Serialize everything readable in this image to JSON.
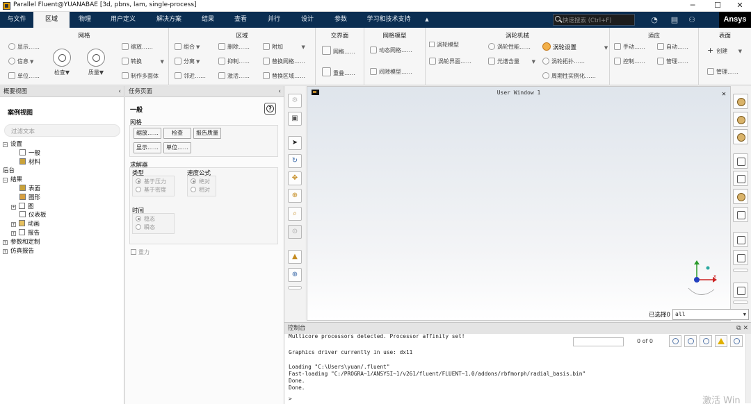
{
  "window": {
    "title": "Parallel Fluent@YUANABAE  [3d, pbns, lam, single-process]",
    "minimize": "─",
    "maximize": "☐",
    "close": "✕"
  },
  "menubar": {
    "items": [
      {
        "label": "与文件",
        "active": false
      },
      {
        "label": "区域",
        "active": true
      },
      {
        "label": "物理",
        "active": false
      },
      {
        "label": "用户定义",
        "active": false
      },
      {
        "label": "解决方案",
        "active": false
      },
      {
        "label": "结果",
        "active": false
      },
      {
        "label": "查看",
        "active": false
      },
      {
        "label": "并行",
        "active": false
      },
      {
        "label": "设计",
        "active": false
      },
      {
        "label": "参数",
        "active": false
      },
      {
        "label": "学习和技术支持",
        "active": false
      }
    ],
    "collapse_arrow": "▲",
    "search_placeholder": "快速搜索 (Ctrl+F)",
    "brand": "Ansys"
  },
  "ribbon": {
    "mesh": {
      "title": "网格",
      "display": "显示……",
      "info": "信息",
      "units": "单位……",
      "check": "检查",
      "quality": "质量",
      "scale": "缩放……",
      "transform": "转换",
      "make_polyhedra": "制作多面体"
    },
    "zones": {
      "title": "区域",
      "combine": "组合",
      "separate": "分离",
      "adjacency": "邻近……",
      "delete": "删除……",
      "deactivate": "抑制……",
      "activate": "激活……",
      "append": "附加",
      "replace_mesh": "替换网格……",
      "replace_zone": "替换区域……"
    },
    "interfaces": {
      "title": "交界面",
      "mesh": "网格……",
      "overset": "重叠……"
    },
    "mesh_models": {
      "title": "网格模型",
      "dynamic_mesh": "动态网格……",
      "gap_model": "间隙模型……"
    },
    "turbo": {
      "title": "涡轮机械",
      "turbo_model": "涡轮模型",
      "turbo_interface": "涡轮界面……",
      "turbo_performance": "涡轮性能……",
      "spectral_content": "光谱含量",
      "turbo_setup": "涡轮设置",
      "turbo_topology": "涡轮拓扑……",
      "periodic_instancing": "周期性实例化……"
    },
    "adapt": {
      "title": "适应",
      "manual": "手动……",
      "automatic": "自动……",
      "control": "控制……",
      "manage": "管理……"
    },
    "surface": {
      "title": "表面",
      "create": "创建",
      "manage": "管理……"
    }
  },
  "outline": {
    "header": "概要视图",
    "case_view": "案例视图",
    "filter_placeholder": "过滤文本",
    "tree": [
      {
        "label": "设置",
        "pm": "⊟",
        "indent": 0
      },
      {
        "label": "一般",
        "pm": "",
        "indent": 2
      },
      {
        "label": "材料",
        "pm": "",
        "indent": 2
      },
      {
        "label": "后台",
        "pm": "",
        "indent": 0
      },
      {
        "label": "结果",
        "pm": "⊟",
        "indent": 0
      },
      {
        "label": "表面",
        "pm": "",
        "indent": 2
      },
      {
        "label": "图形",
        "pm": "",
        "indent": 2
      },
      {
        "label": "图",
        "pm": "+",
        "indent": 1
      },
      {
        "label": "仪表板",
        "pm": "",
        "indent": 2
      },
      {
        "label": "动画",
        "pm": "+",
        "indent": 1
      },
      {
        "label": "报告",
        "pm": "+",
        "indent": 1
      },
      {
        "label": "参数和定制",
        "pm": "+",
        "indent": 0
      },
      {
        "label": "仿真报告",
        "pm": "+",
        "indent": 0
      }
    ]
  },
  "taskpage": {
    "header": "任务页面",
    "title": "一般",
    "mesh_label": "网格",
    "btn_scale": "缩放……",
    "btn_check": "检查",
    "btn_report_quality": "报告质量",
    "btn_display": "显示……",
    "btn_units": "单位……",
    "solver_label": "求解器",
    "type_label": "类型",
    "pressure_based": "基于压力",
    "density_based": "基于密度",
    "velocity_formulation": "速度公式",
    "absolute": "绝对",
    "relative": "相对",
    "time_label": "时间",
    "steady": "稳态",
    "transient": "瞬态",
    "gravity": "重力",
    "help": "?"
  },
  "graphics": {
    "window_title": "User Window 1",
    "close": "✕",
    "selected_label": "已选择0",
    "selection_value": "all"
  },
  "console": {
    "header": "控制台",
    "found": "0 of 0",
    "lines": [
      "Multicore processors detected. Processor affinity set!",
      "",
      "Graphics driver currently in use: dx11",
      "",
      "Loading \"C:\\Users\\yuan/.fluent\"",
      "Fast-loading \"C:/PROGRA~1/ANSYSI~1/v261/fluent/FLUENT~1.0/addons/rbfmorph/radial_basis.bin\"",
      "Done.",
      "Done."
    ],
    "prompt": ">"
  },
  "watermark": "激活 Win",
  "colors": {
    "menubar_bg": "#0b2e52",
    "brand_bg": "#000000",
    "accent_orange": "#f2b04a"
  }
}
